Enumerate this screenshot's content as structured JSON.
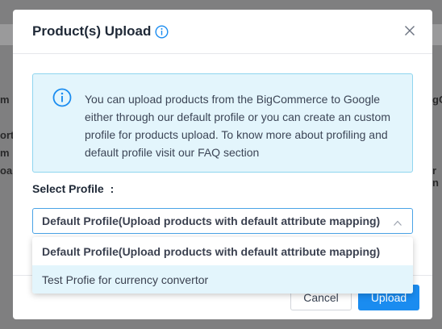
{
  "background": {
    "fragments_left": [
      "m B",
      "orte",
      "m ‘",
      "oa"
    ],
    "fragments_right": [
      "gC",
      "r n"
    ]
  },
  "modal": {
    "title": "Product(s) Upload",
    "title_icon": "info-circle-icon",
    "close_icon": "close-icon"
  },
  "info_box": {
    "icon": "info-circle-icon",
    "text": "You can upload products from the BigCommerce to Google either through our default profile or you can create an custom profile for products upload. To know more about profiling and default profile visit our FAQ section"
  },
  "profile_select": {
    "label": "Select Profile",
    "label_suffix": ":",
    "selected_value": "Default Profile(Upload products with default attribute mapping)",
    "chevron_icon": "chevron-up-icon",
    "options": [
      "Default Profile(Upload products with default attribute mapping)",
      "Test Profie for currency convertor"
    ]
  },
  "footer": {
    "cancel_label": "Cancel",
    "upload_label": "Upload"
  },
  "colors": {
    "accent": "#1a8cf0",
    "info_bg": "#e3f5fc",
    "info_border": "#8fd5ef",
    "overlay": "#7f7f80"
  }
}
